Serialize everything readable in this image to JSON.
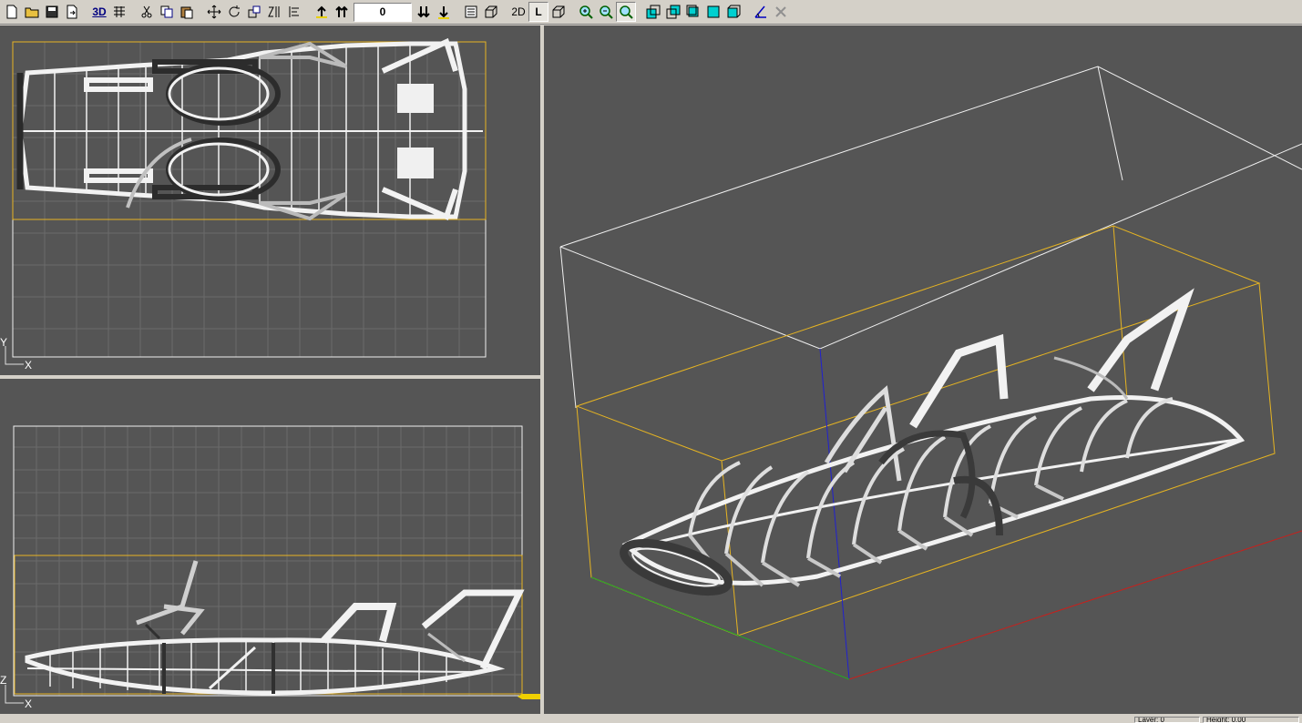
{
  "toolbar": {
    "buttons": [
      "new-document-icon",
      "open-folder-icon",
      "save-icon",
      "export-icon",
      "3d-view-icon",
      "grid-settings-icon",
      "cut-icon",
      "copy-icon",
      "paste-icon",
      "move-icon",
      "rotate-icon",
      "scale-icon",
      "z-sort-icon",
      "align-icon",
      "raise-icon",
      "raise-top-icon",
      "lower-bottom-icon",
      "lower-icon",
      "layers-icon",
      "box-icon",
      "zoom-in-icon",
      "zoom-out-icon",
      "zoom-fit-icon",
      "view-front-icon",
      "view-back-icon",
      "view-side-icon",
      "view-top-icon",
      "view-iso-icon",
      "measure-icon",
      "tools-disabled-icon"
    ],
    "label_3d": "3D",
    "label_2d": "2D",
    "label_l": "L",
    "value_field": "0"
  },
  "viewports": {
    "top_axis": {
      "x": "X",
      "y": "Y"
    },
    "front_axis": {
      "x": "X",
      "z": "Z"
    }
  },
  "colors": {
    "viewport_bg": "#555555",
    "grid": "#6a6a6a",
    "bbox_yellow": "#e6b422",
    "model_white": "#f2f2f2",
    "axis_x": "#c8201c",
    "axis_y": "#22aa22",
    "axis_z": "#2020d0"
  },
  "statusbar": {
    "layer": "Layer: 0",
    "height": "Height: 0.00"
  }
}
